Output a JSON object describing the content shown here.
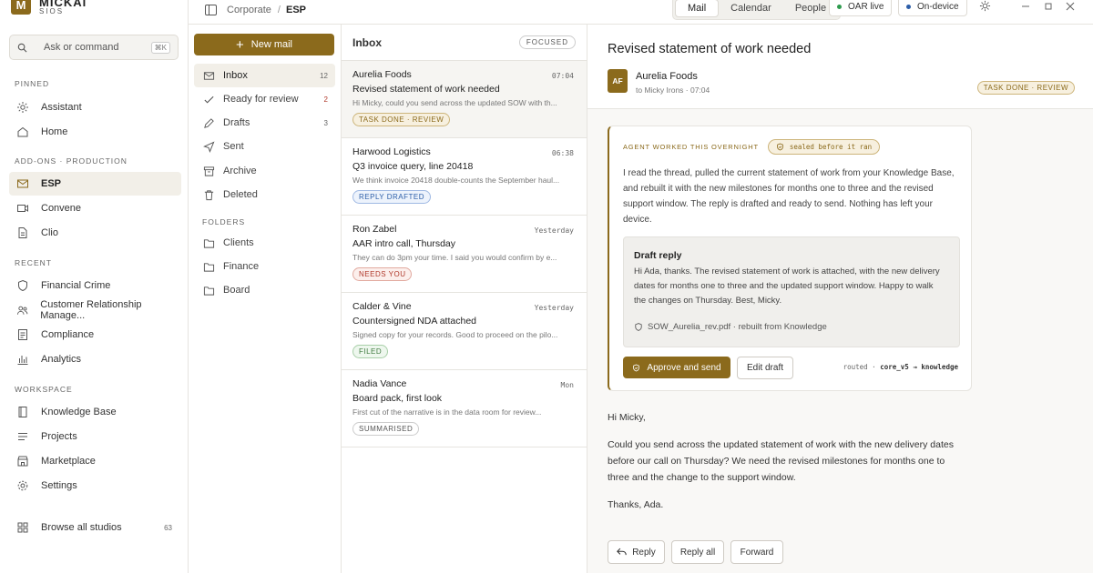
{
  "brand": {
    "initial": "M",
    "name": "MICKAI",
    "sub": "SIOS"
  },
  "sidebar": {
    "search": {
      "placeholder": "Ask or command",
      "shortcut": "⌘K"
    },
    "pinned_title": "PINNED",
    "pinned": [
      {
        "label": "Assistant"
      },
      {
        "label": "Home"
      }
    ],
    "addons_title": "ADD-ONS · PRODUCTION",
    "addons": [
      {
        "label": "ESP"
      },
      {
        "label": "Convene"
      },
      {
        "label": "Clio"
      }
    ],
    "recent_title": "RECENT",
    "recent": [
      {
        "label": "Financial Crime"
      },
      {
        "label": "Customer Relationship Manage..."
      },
      {
        "label": "Compliance"
      },
      {
        "label": "Analytics"
      }
    ],
    "workspace_title": "WORKSPACE",
    "workspace": [
      {
        "label": "Knowledge Base"
      },
      {
        "label": "Projects"
      },
      {
        "label": "Marketplace"
      },
      {
        "label": "Settings"
      }
    ],
    "browse": {
      "label": "Browse all studios",
      "count": "63"
    }
  },
  "topbar": {
    "breadcrumb": [
      "Corporate",
      "ESP"
    ],
    "tabs": [
      "Mail",
      "Calendar",
      "People"
    ],
    "status": [
      {
        "label": "OAR live",
        "color": "#2e9b4e"
      },
      {
        "label": "On-device",
        "color": "#2c5ea8"
      }
    ]
  },
  "folders": {
    "new_mail": "New mail",
    "items": [
      {
        "label": "Inbox",
        "count": "12"
      },
      {
        "label": "Ready for review",
        "count": "2"
      },
      {
        "label": "Drafts",
        "count": "3"
      },
      {
        "label": "Sent",
        "count": ""
      },
      {
        "label": "Archive",
        "count": ""
      },
      {
        "label": "Deleted",
        "count": ""
      }
    ],
    "folders_title": "FOLDERS",
    "folders": [
      {
        "label": "Clients"
      },
      {
        "label": "Finance"
      },
      {
        "label": "Board"
      }
    ]
  },
  "list": {
    "title": "Inbox",
    "filter": "FOCUSED",
    "messages": [
      {
        "from": "Aurelia Foods",
        "time": "07:04",
        "subject": "Revised statement of work needed",
        "preview": "Hi Micky, could you send across the updated SOW with th...",
        "tag": "TASK DONE · REVIEW"
      },
      {
        "from": "Harwood Logistics",
        "time": "06:38",
        "subject": "Q3 invoice query, line 20418",
        "preview": "We think invoice 20418 double-counts the September haul...",
        "tag": "REPLY DRAFTED"
      },
      {
        "from": "Ron Zabel",
        "time": "Yesterday",
        "subject": "AAR intro call, Thursday",
        "preview": "They can do 3pm your time. I said you would confirm by e...",
        "tag": "NEEDS YOU"
      },
      {
        "from": "Calder & Vine",
        "time": "Yesterday",
        "subject": "Countersigned NDA attached",
        "preview": "Signed copy for your records. Good to proceed on the pilo...",
        "tag": "FILED"
      },
      {
        "from": "Nadia Vance",
        "time": "Mon",
        "subject": "Board pack, first look",
        "preview": "First cut of the narrative is in the data room for review...",
        "tag": "SUMMARISED"
      }
    ]
  },
  "reader": {
    "title": "Revised statement of work needed",
    "avatar": "AF",
    "from": "Aurelia Foods",
    "to": "to Micky Irons · 07:04",
    "tag": "TASK DONE · REVIEW",
    "agent": {
      "heading": "AGENT WORKED THIS OVERNIGHT",
      "seal": "sealed before it ran",
      "text": "I read the thread, pulled the current statement of work from your Knowledge Base, and rebuilt it with the new milestones for months one to three and the revised support window. The reply is drafted and ready to send. Nothing has left your device.",
      "draft_title": "Draft reply",
      "draft_text": "Hi Ada, thanks. The revised statement of work is attached, with the new delivery dates for months one to three and the updated support window. Happy to walk the changes on Thursday. Best, Micky.",
      "attachment": "SOW_Aurelia_rev.pdf · rebuilt from Knowledge",
      "approve": "Approve and send",
      "edit": "Edit draft",
      "routed_label": "routed ·",
      "routed_path": "core_v5 → knowledge"
    },
    "email": [
      "Hi Micky,",
      "Could you send across the updated statement of work with the new delivery dates before our call on Thursday? We need the revised milestones for months one to three and the change to the support window.",
      "Thanks, Ada."
    ],
    "actions": {
      "reply": "Reply",
      "reply_all": "Reply all",
      "forward": "Forward"
    }
  }
}
